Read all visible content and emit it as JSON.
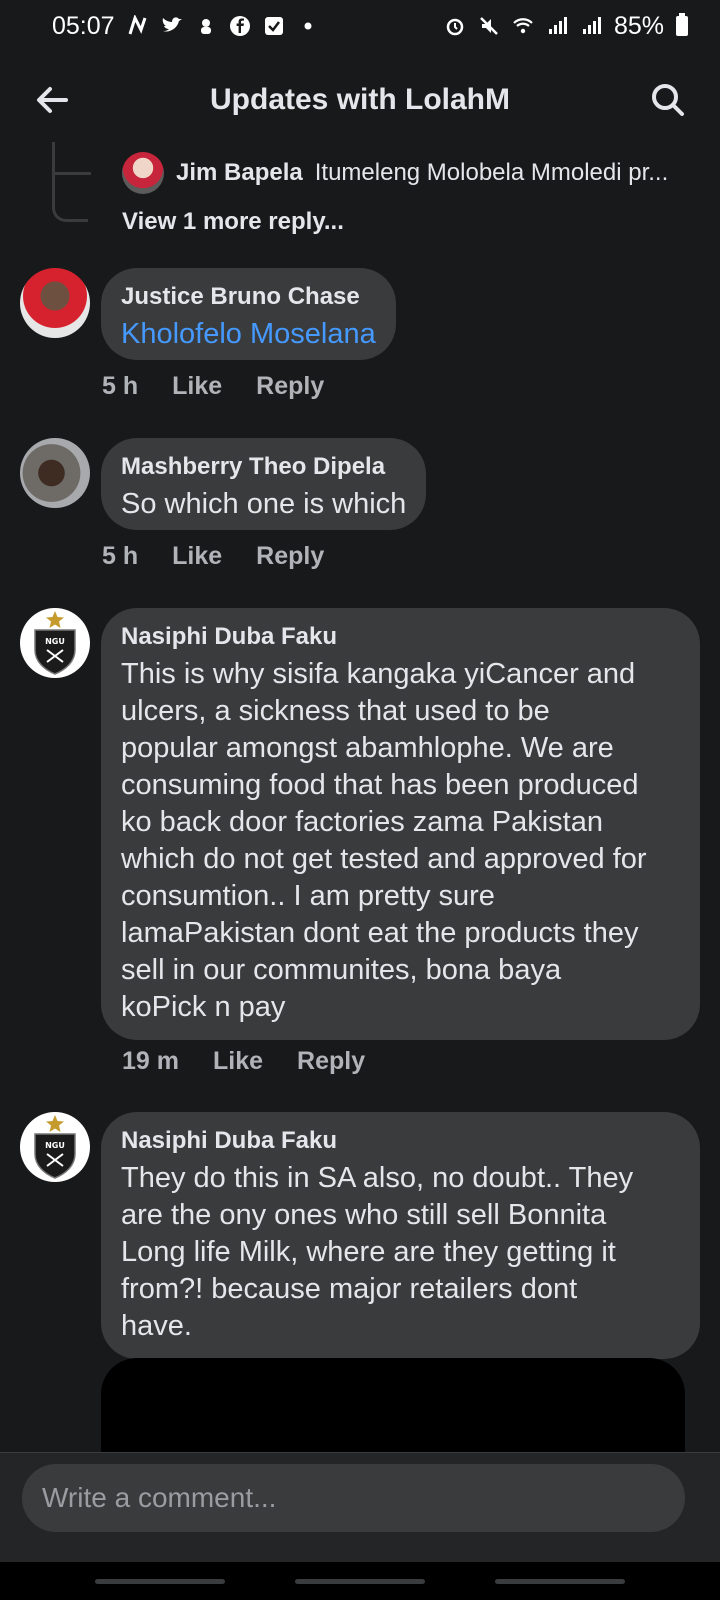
{
  "status_bar": {
    "time": "05:07",
    "battery": "85%",
    "icons_left": [
      "n-icon",
      "twitter-icon",
      "mute-icon",
      "facebook-icon",
      "check-icon",
      "dot-icon"
    ],
    "icons_right": [
      "alarm-icon",
      "mute-icon",
      "wifi-icon",
      "signal-icon",
      "signal-icon",
      "battery-icon"
    ]
  },
  "app_bar": {
    "title": "Updates with LolahM",
    "back_icon": "arrow-left-icon",
    "search_icon": "search-icon"
  },
  "thread": {
    "nested_reply": {
      "author": "Jim Bapela",
      "text": "Itumeleng Molobela Mmoledi pr..."
    },
    "view_more": "View 1 more reply..."
  },
  "comments": [
    {
      "author": "Justice Bruno Chase",
      "text": "Kholofelo Moselana",
      "is_mention": true,
      "time": "5 h",
      "like": "Like",
      "reply": "Reply"
    },
    {
      "author": "Mashberry Theo Dipela",
      "text": "So which one is which",
      "time": "5 h",
      "like": "Like",
      "reply": "Reply"
    },
    {
      "author": "Nasiphi Duba Faku",
      "lines": [
        "This is why sisifa kangaka yiCancer and",
        "ulcers, a sickness that used to be",
        "popular amongst abamhlophe. We are",
        "consuming food that has been produced",
        "ko back door factories zama Pakistan",
        "which do not get tested and approved for",
        "consumtion.. I am pretty sure",
        "lamaPakistan dont eat the products they",
        "sell in our communites, bona baya",
        "koPick n pay"
      ],
      "time": "19 m",
      "like": "Like",
      "reply": "Reply"
    },
    {
      "author": "Nasiphi Duba Faku",
      "lines": [
        "They do this in SA also, no doubt.. They",
        "are the ony ones who still sell Bonnita",
        "Long life Milk, where are they getting it",
        "from?! because major retailers dont",
        "have."
      ]
    }
  ],
  "composer": {
    "placeholder": "Write a comment..."
  },
  "colors": {
    "background": "#18191a",
    "bubble": "#3a3b3c",
    "mention": "#4599ff",
    "meta": "#b0b3b8"
  }
}
